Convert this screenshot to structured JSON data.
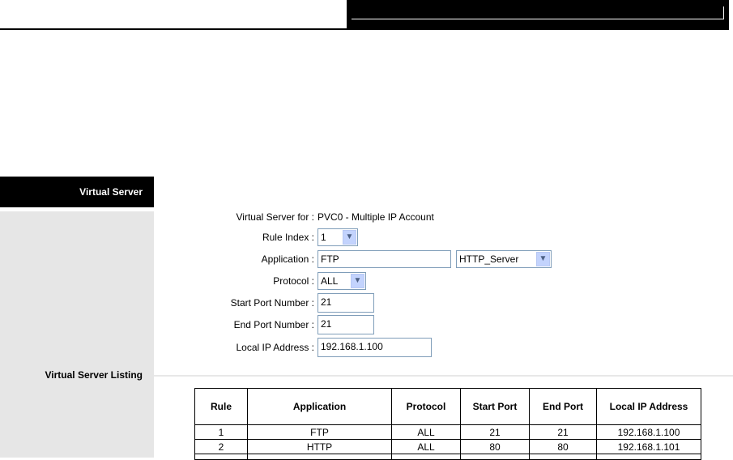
{
  "sidebar": {
    "header": "Virtual Server",
    "listing_label": "Virtual Server Listing"
  },
  "form": {
    "virtual_server_for": {
      "label": "Virtual Server for :",
      "value": "PVC0 - Multiple IP Account"
    },
    "rule_index": {
      "label": "Rule Index :",
      "value": "1"
    },
    "application": {
      "label": "Application :",
      "value": "FTP",
      "preset": "HTTP_Server"
    },
    "protocol": {
      "label": "Protocol :",
      "value": "ALL"
    },
    "start_port": {
      "label": "Start Port Number :",
      "value": "21"
    },
    "end_port": {
      "label": "End Port Number :",
      "value": "21"
    },
    "local_ip": {
      "label": "Local IP Address :",
      "value": "192.168.1.100"
    }
  },
  "table": {
    "headers": [
      "Rule",
      "Application",
      "Protocol",
      "Start Port",
      "End Port",
      "Local IP Address"
    ],
    "rows": [
      [
        "1",
        "FTP",
        "ALL",
        "21",
        "21",
        "192.168.1.100"
      ],
      [
        "2",
        "HTTP",
        "ALL",
        "80",
        "80",
        "192.168.1.101"
      ]
    ]
  },
  "icons": {
    "dropdown": "chevron-down-icon"
  },
  "colors": {
    "sidebar_bg": "#e6e6e6",
    "header_bg": "#000000",
    "input_border": "#7f9db9",
    "dropdown_button": "#c3d3fd"
  }
}
